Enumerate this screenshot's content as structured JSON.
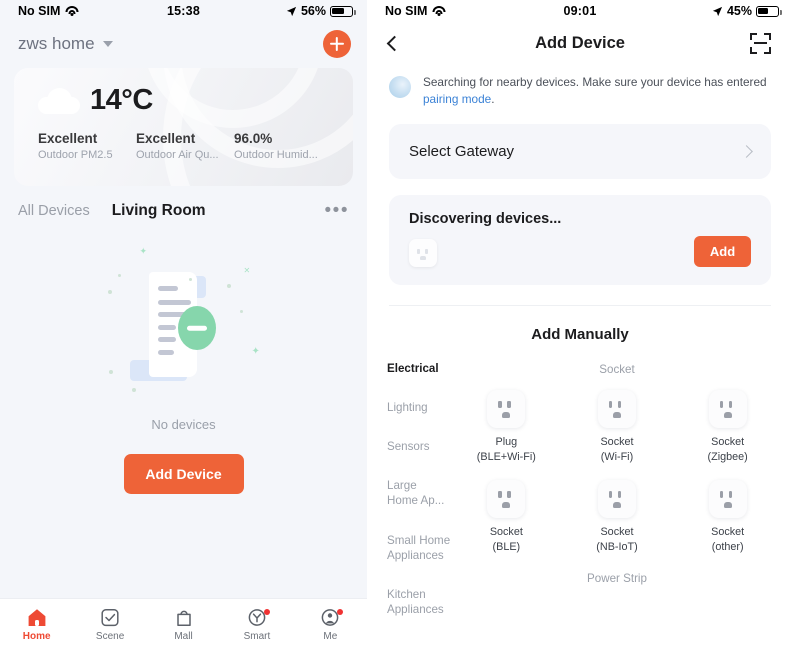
{
  "left": {
    "status": {
      "carrier": "No SIM",
      "time": "15:38",
      "battery": "56%"
    },
    "header": {
      "home_name": "zws home",
      "add_icon": "plus-icon"
    },
    "weather": {
      "temperature": "14°C",
      "icon": "cloud-icon",
      "stats": [
        {
          "value": "Excellent",
          "label": "Outdoor PM2.5"
        },
        {
          "value": "Excellent",
          "label": "Outdoor Air Qu..."
        },
        {
          "value": "96.0%",
          "label": "Outdoor Humid..."
        }
      ]
    },
    "room_tabs": [
      {
        "label": "All Devices",
        "active": false
      },
      {
        "label": "Living Room",
        "active": true
      }
    ],
    "more_label": "•••",
    "empty": {
      "text": "No devices",
      "button": "Add Device"
    },
    "tabbar": [
      {
        "label": "Home",
        "icon": "home-icon",
        "active": true,
        "badge": false
      },
      {
        "label": "Scene",
        "icon": "check-square-icon",
        "active": false,
        "badge": false
      },
      {
        "label": "Mall",
        "icon": "shopping-bag-icon",
        "active": false,
        "badge": false
      },
      {
        "label": "Smart",
        "icon": "smart-circle-icon",
        "active": false,
        "badge": true
      },
      {
        "label": "Me",
        "icon": "person-circle-icon",
        "active": false,
        "badge": true
      }
    ]
  },
  "right": {
    "status": {
      "carrier": "No SIM",
      "time": "09:01",
      "battery": "45%"
    },
    "nav": {
      "title": "Add Device",
      "back_icon": "chevron-left-icon",
      "scan_icon": "scan-qr-icon"
    },
    "search": {
      "icon": "radar-icon",
      "text_before": "Searching for nearby devices. Make sure your device has entered ",
      "link": "pairing mode",
      "text_after": "."
    },
    "gateway": {
      "label": "Select Gateway",
      "chevron": "chevron-right-icon"
    },
    "discovering": {
      "title": "Discovering devices...",
      "add_button": "Add",
      "thumb_icon": "socket-icon"
    },
    "manual_title": "Add Manually",
    "categories": [
      {
        "label": "Electrical",
        "active": true
      },
      {
        "label": "Lighting",
        "active": false
      },
      {
        "label": "Sensors",
        "active": false
      },
      {
        "label": "Large\nHome Ap...",
        "active": false
      },
      {
        "label": "Small Home\nAppliances",
        "active": false
      },
      {
        "label": "Kitchen\nAppliances",
        "active": false
      }
    ],
    "sections": [
      {
        "title": "Socket",
        "items": [
          {
            "name": "Plug\n(BLE+Wi-Fi)",
            "icon": "socket-icon"
          },
          {
            "name": "Socket\n(Wi-Fi)",
            "icon": "socket-icon"
          },
          {
            "name": "Socket\n(Zigbee)",
            "icon": "socket-icon"
          },
          {
            "name": "Socket\n(BLE)",
            "icon": "socket-icon"
          },
          {
            "name": "Socket\n(NB-IoT)",
            "icon": "socket-icon"
          },
          {
            "name": "Socket\n(other)",
            "icon": "socket-icon"
          }
        ]
      },
      {
        "title": "Power Strip",
        "items": []
      }
    ]
  },
  "colors": {
    "accent": "#ee6338",
    "active_tab": "#ee4a34",
    "link": "#3b82d6",
    "bg": "#f4f6fa"
  }
}
